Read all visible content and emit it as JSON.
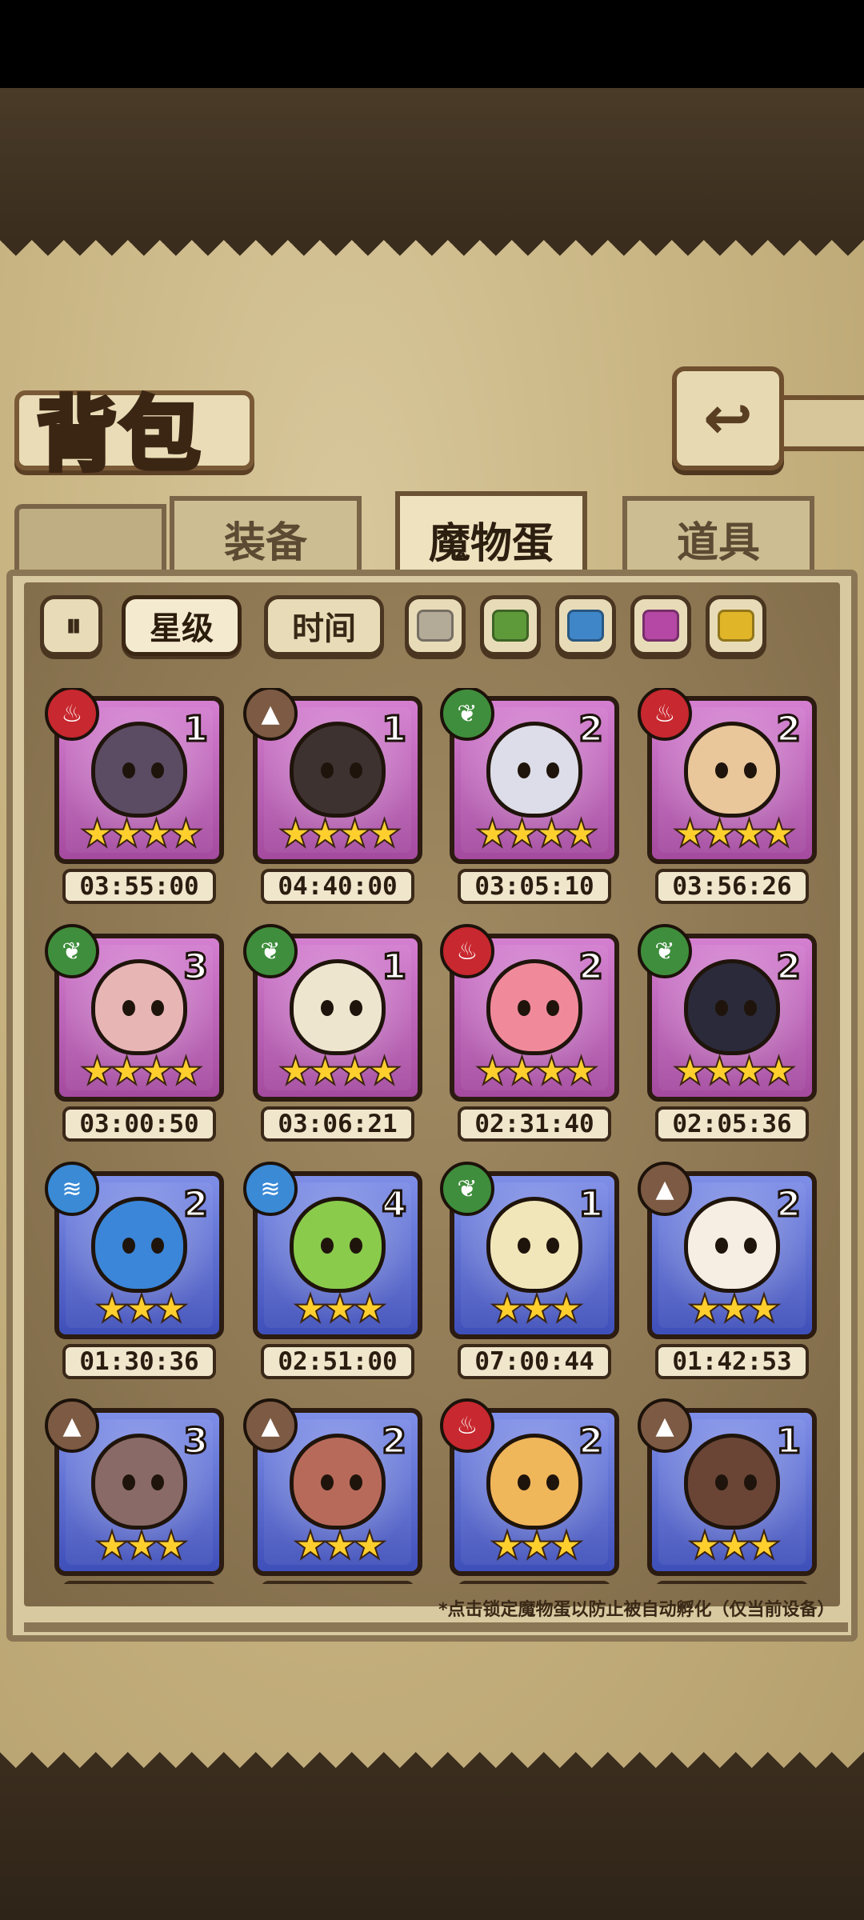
{
  "header": {
    "title": "背包",
    "back_icon": "back-arrow-icon"
  },
  "tabs": [
    {
      "label": "装备",
      "active": false
    },
    {
      "label": "魔物蛋",
      "active": true
    },
    {
      "label": "道具",
      "active": false
    }
  ],
  "filters": {
    "sort_icon": "sort-toggle-icon",
    "star_label": "星级",
    "time_label": "时间",
    "star_selected": true,
    "colors": [
      {
        "name": "gray",
        "hex": "#b4aa98"
      },
      {
        "name": "green",
        "hex": "#5f9a3a"
      },
      {
        "name": "blue",
        "hex": "#3f86c8"
      },
      {
        "name": "purple",
        "hex": "#b548a4"
      },
      {
        "name": "yellow",
        "hex": "#e0b528"
      }
    ]
  },
  "eggs": [
    {
      "element": "fire",
      "element_glyph": "♨",
      "count": "1",
      "stars": "★★★★",
      "rarity": "epic",
      "time": "03:55:00",
      "body": "#5b4c63"
    },
    {
      "element": "earth",
      "element_glyph": "▲",
      "count": "1",
      "stars": "★★★★",
      "rarity": "epic",
      "time": "04:40:00",
      "body": "#3e3230"
    },
    {
      "element": "grass",
      "element_glyph": "❦",
      "count": "2",
      "stars": "★★★★",
      "rarity": "epic",
      "time": "03:05:10",
      "body": "#dcdde8"
    },
    {
      "element": "fire",
      "element_glyph": "♨",
      "count": "2",
      "stars": "★★★★",
      "rarity": "epic",
      "time": "03:56:26",
      "body": "#e9c79a"
    },
    {
      "element": "grass",
      "element_glyph": "❦",
      "count": "3",
      "stars": "★★★★",
      "rarity": "epic",
      "time": "03:00:50",
      "body": "#e8b5b5"
    },
    {
      "element": "grass",
      "element_glyph": "❦",
      "count": "1",
      "stars": "★★★★",
      "rarity": "epic",
      "time": "03:06:21",
      "body": "#eee5cf"
    },
    {
      "element": "fire",
      "element_glyph": "♨",
      "count": "2",
      "stars": "★★★★",
      "rarity": "epic",
      "time": "02:31:40",
      "body": "#f08a9a"
    },
    {
      "element": "grass",
      "element_glyph": "❦",
      "count": "2",
      "stars": "★★★★",
      "rarity": "epic",
      "time": "02:05:36",
      "body": "#2a2a3a"
    },
    {
      "element": "water",
      "element_glyph": "≋",
      "count": "2",
      "stars": "★★★",
      "rarity": "rare",
      "time": "01:30:36",
      "body": "#3b86d8"
    },
    {
      "element": "water",
      "element_glyph": "≋",
      "count": "4",
      "stars": "★★★",
      "rarity": "rare",
      "time": "02:51:00",
      "body": "#8acb4c"
    },
    {
      "element": "grass",
      "element_glyph": "❦",
      "count": "1",
      "stars": "★★★",
      "rarity": "rare",
      "time": "07:00:44",
      "body": "#f1e6b9"
    },
    {
      "element": "earth",
      "element_glyph": "▲",
      "count": "2",
      "stars": "★★★",
      "rarity": "rare",
      "time": "01:42:53",
      "body": "#f6ede3"
    },
    {
      "element": "earth",
      "element_glyph": "▲",
      "count": "3",
      "stars": "★★★",
      "rarity": "rare",
      "time": "",
      "body": "#8a6a66"
    },
    {
      "element": "earth",
      "element_glyph": "▲",
      "count": "2",
      "stars": "★★★",
      "rarity": "rare",
      "time": "",
      "body": "#b86a5a"
    },
    {
      "element": "fire",
      "element_glyph": "♨",
      "count": "2",
      "stars": "★★★",
      "rarity": "rare",
      "time": "",
      "body": "#f0b65a"
    },
    {
      "element": "earth",
      "element_glyph": "▲",
      "count": "1",
      "stars": "★★★",
      "rarity": "rare",
      "time": "",
      "body": "#6a4536"
    }
  ],
  "footnote": "*点击锁定魔物蛋以防止被自动孵化（仅当前设备）"
}
